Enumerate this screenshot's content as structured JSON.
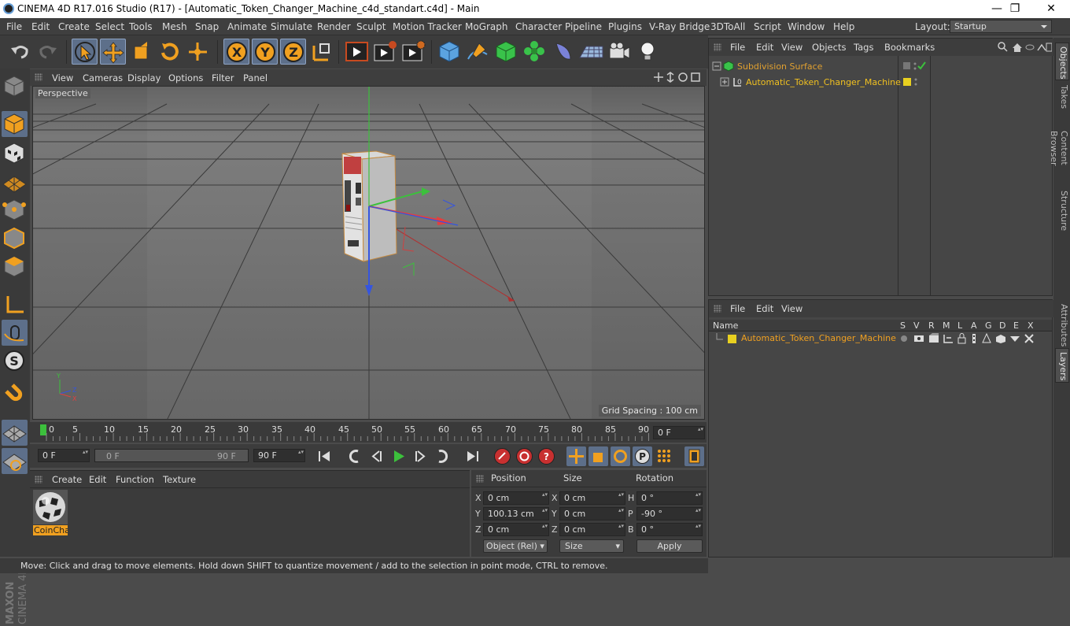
{
  "window": {
    "title": "CINEMA 4D R17.016 Studio (R17) - [Automatic_Token_Changer_Machine_c4d_standart.c4d] - Main",
    "minimize": "—",
    "maximize": "❐",
    "close": "✕"
  },
  "menubar": {
    "items": [
      "File",
      "Edit",
      "Create",
      "Select",
      "Tools",
      "Mesh",
      "Snap",
      "Animate",
      "Simulate",
      "Render",
      "Sculpt",
      "Motion Tracker",
      "MoGraph",
      "Character",
      "Pipeline",
      "Plugins",
      "V-Ray Bridge",
      "3DToAll",
      "Script",
      "Window",
      "Help"
    ],
    "layout_label": "Layout:",
    "layout_value": "Startup"
  },
  "toolbar": {
    "icons": [
      "undo-icon",
      "redo-icon",
      "select-arrow-icon",
      "move-icon",
      "scale-icon",
      "rotate-icon",
      "multi-transform-icon",
      "x-axis-icon",
      "y-axis-icon",
      "z-axis-icon",
      "coordinate-system-icon",
      "render-view-icon",
      "render-picture-viewer-icon",
      "render-settings-icon",
      "cube-primitive-icon",
      "pen-spline-icon",
      "subdivision-icon",
      "cloner-icon",
      "deformer-icon",
      "floor-icon",
      "camera-icon",
      "light-icon"
    ],
    "axis_labels": [
      "X",
      "Y",
      "Z"
    ]
  },
  "viewport": {
    "menu": [
      "View",
      "Cameras",
      "Display",
      "Options",
      "Filter",
      "Panel"
    ],
    "camera_label": "Perspective",
    "grid_spacing": "Grid Spacing : 100 cm",
    "axis_labels": {
      "x": "X",
      "y": "Y",
      "z": "Z"
    }
  },
  "timeline": {
    "ticks": [
      "0",
      "5",
      "10",
      "15",
      "20",
      "25",
      "30",
      "35",
      "40",
      "45",
      "50",
      "55",
      "60",
      "65",
      "70",
      "75",
      "80",
      "85",
      "90"
    ],
    "current_frame_field": "0 F"
  },
  "playback": {
    "start_field": "0 F",
    "range_min": "0 F",
    "range_max": "90 F",
    "end_field": "90 F"
  },
  "material_manager": {
    "menu": [
      "Create",
      "Edit",
      "Function",
      "Texture"
    ],
    "materials": [
      {
        "name": "CoinCha"
      }
    ]
  },
  "coordinates": {
    "headers": {
      "position": "Position",
      "size": "Size",
      "rotation": "Rotation"
    },
    "rows": [
      {
        "axis": "X",
        "position": "0 cm",
        "size_axis": "X",
        "size": "0 cm",
        "rot_axis": "H",
        "rotation": "0 °"
      },
      {
        "axis": "Y",
        "position": "100.13 cm",
        "size_axis": "Y",
        "size": "0 cm",
        "rot_axis": "P",
        "rotation": "-90 °"
      },
      {
        "axis": "Z",
        "position": "0 cm",
        "size_axis": "Z",
        "size": "0 cm",
        "rot_axis": "B",
        "rotation": "0 °"
      }
    ],
    "mode_select": "Object (Rel)",
    "size_select": "Size",
    "apply_label": "Apply"
  },
  "object_manager": {
    "menu": [
      "File",
      "Edit",
      "View",
      "Objects",
      "Tags",
      "Bookmarks"
    ],
    "objects": [
      {
        "name": "Subdivision Surface",
        "color": "#e0a030"
      },
      {
        "name": "Automatic_Token_Changer_Machine",
        "color": "#f0c020"
      }
    ]
  },
  "layer_manager": {
    "menu": [
      "File",
      "Edit",
      "View"
    ],
    "columns": [
      "Name",
      "S",
      "V",
      "R",
      "M",
      "L",
      "A",
      "G",
      "D",
      "E",
      "X"
    ],
    "layers": [
      {
        "name": "Automatic_Token_Changer_Machine",
        "color": "#e8d020"
      }
    ]
  },
  "right_tabs": [
    "Objects",
    "Takes",
    "Content Browser",
    "Structure",
    "Attributes",
    "Layers"
  ],
  "status": {
    "text": "Move: Click and drag to move elements. Hold down SHIFT to quantize movement / add to the selection in point mode, CTRL to remove."
  },
  "colors": {
    "accent": "#f0a020",
    "selection_blue": "#5d6f8a",
    "background": "#4b4b4b"
  }
}
